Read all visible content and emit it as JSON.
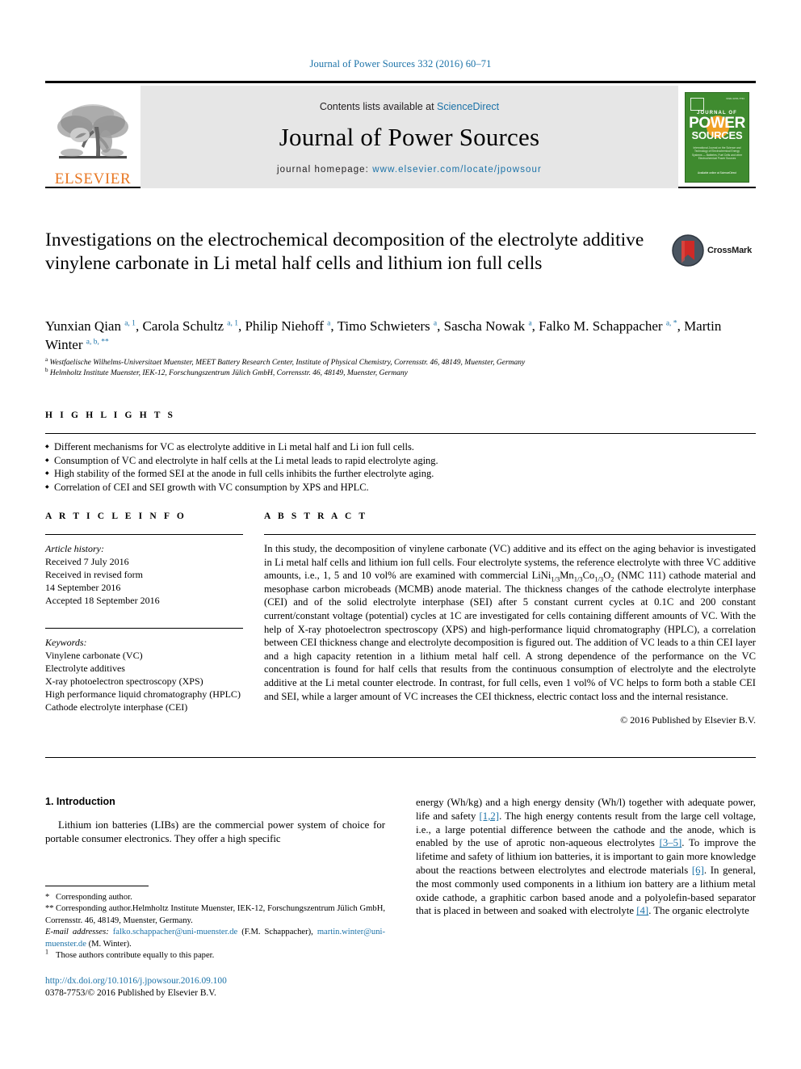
{
  "running_head": "Journal of Power Sources 332 (2016) 60–71",
  "masthead": {
    "publisher_name": "ELSEVIER",
    "contents_prefix": "Contents lists available at ",
    "contents_link": "ScienceDirect",
    "journal_title": "Journal of Power Sources",
    "homepage_prefix": "journal homepage: ",
    "homepage_url": "www.elsevier.com/locate/jpowsour",
    "cover": {
      "issn": "ISSN 0378-7753",
      "line_journal_of": "JOURNAL OF",
      "line_power": "POWER",
      "line_sources": "SOURCES",
      "subtitle": "International Journal on the Science and Technology of Electrochemical Energy Systems — Batteries, Fuel Cells and other Electrochemical Power Sources",
      "footer": "Available online at ScienceDirect"
    }
  },
  "article": {
    "title": "Investigations on the electrochemical decomposition of the electrolyte additive vinylene carbonate in Li metal half cells and lithium ion full cells",
    "crossmark_label": "CrossMark",
    "authors": [
      {
        "name": "Yunxian Qian",
        "sup": "a, 1",
        "sep": ", "
      },
      {
        "name": "Carola Schultz",
        "sup": "a, 1",
        "sep": ", "
      },
      {
        "name": "Philip Niehoff",
        "sup": "a",
        "sep": ", "
      },
      {
        "name": "Timo Schwieters",
        "sup": "a",
        "sep": ", "
      },
      {
        "name": "Sascha Nowak",
        "sup": "a",
        "sep": ", "
      },
      {
        "name": "Falko M. Schappacher",
        "sup": "a, *",
        "sep": ", "
      },
      {
        "name": "Martin Winter",
        "sup": "a, b, **",
        "sep": ""
      }
    ],
    "affiliations": [
      {
        "mark": "a",
        "text": "Westfaelische Wilhelms-Universitaet Muenster, MEET Battery Research Center, Institute of Physical Chemistry, Corrensstr. 46, 48149, Muenster, Germany"
      },
      {
        "mark": "b",
        "text": "Helmholtz Institute Muenster, IEK-12, Forschungszentrum Jülich GmbH, Corrensstr. 46, 48149, Muenster, Germany"
      }
    ]
  },
  "highlights": {
    "heading": "H I G H L I G H T S",
    "items": [
      "Different mechanisms for VC as electrolyte additive in Li metal half and Li ion full cells.",
      "Consumption of VC and electrolyte in half cells at the Li metal leads to rapid electrolyte aging.",
      "High stability of the formed SEI at the anode in full cells inhibits the further electrolyte aging.",
      "Correlation of CEI and SEI growth with VC consumption by XPS and HPLC."
    ]
  },
  "article_info": {
    "heading": "A R T I C L E  I N F O",
    "history_label": "Article history:",
    "history": [
      "Received 7 July 2016",
      "Received in revised form",
      "14 September 2016",
      "Accepted 18 September 2016"
    ],
    "keywords_label": "Keywords:",
    "keywords": [
      "Vinylene carbonate (VC)",
      "Electrolyte additives",
      "X-ray photoelectron spectroscopy (XPS)",
      "High performance liquid chromatography (HPLC)",
      "Cathode electrolyte interphase (CEI)"
    ]
  },
  "abstract": {
    "heading": "A B S T R A C T",
    "part1": "In this study, the decomposition of vinylene carbonate (VC) additive and its effect on the aging behavior is investigated in Li metal half cells and lithium ion full cells. Four electrolyte systems, the reference electrolyte with three VC additive amounts, i.e., 1, 5 and 10 vol% are examined with commercial LiNi",
    "sub1": "1/",
    "part2": "",
    "sub2": "3",
    "part3": "Mn",
    "sub3": "1/3",
    "part4": "Co",
    "sub4": "1/3",
    "part5": "O",
    "sub5": "2",
    "part6": " (NMC 111) cathode material and mesophase carbon microbeads (MCMB) anode material. The thickness changes of the cathode electrolyte interphase (CEI) and of the solid electrolyte interphase (SEI) after 5 constant current cycles at 0.1C and 200 constant current/constant voltage (potential) cycles at 1C are investigated for cells containing different amounts of VC. With the help of X-ray photoelectron spectroscopy (XPS) and high-performance liquid chromatography (HPLC), a correlation between CEI thickness change and electrolyte decomposition is figured out. The addition of VC leads to a thin CEI layer and a high capacity retention in a lithium metal half cell. A strong dependence of the performance on the VC concentration is found for half cells that results from the continuous consumption of electrolyte and the electrolyte additive at the Li metal counter electrode. In contrast, for full cells, even 1 vol% of VC helps to form both a stable CEI and SEI, while a larger amount of VC increases the CEI thickness, electric contact loss and the internal resistance.",
    "copyright": "© 2016 Published by Elsevier B.V."
  },
  "body": {
    "intro_heading": "1. Introduction",
    "left_paragraph": "Lithium ion batteries (LIBs) are the commercial power system of choice for portable consumer electronics. They offer a high specific",
    "right_parts": [
      {
        "text": "energy (Wh/kg) and a high energy density (Wh/l) together with adequate power, life and safety ",
        "cite": ""
      },
      {
        "text": "",
        "cite": "[1,2]"
      },
      {
        "text": ". The high energy contents result from the large cell voltage, i.e., a large potential difference between the cathode and the anode, which is enabled by the use of aprotic non-aqueous electrolytes ",
        "cite": ""
      },
      {
        "text": "",
        "cite": "[3–5]"
      },
      {
        "text": ". To improve the lifetime and safety of lithium ion batteries, it is important to gain more knowledge about the reactions between electrolytes and electrode materials ",
        "cite": ""
      },
      {
        "text": "",
        "cite": "[6]"
      },
      {
        "text": ". In general, the most commonly used components in a lithium ion battery are a lithium metal oxide cathode, a graphitic carbon based anode and a polyolefin-based separator that is placed in between and soaked with electrolyte ",
        "cite": ""
      },
      {
        "text": "",
        "cite": "[4]"
      },
      {
        "text": ". The organic electrolyte",
        "cite": ""
      }
    ]
  },
  "footnotes": {
    "corresponding_1_mark": "*",
    "corresponding_1": "Corresponding author.",
    "corresponding_2_mark": "**",
    "corresponding_2": "Corresponding author.Helmholtz Institute Muenster, IEK-12, Forschungszentrum Jülich GmbH, Corrensstr. 46, 48149, Muenster, Germany.",
    "email_label": "E-mail addresses:",
    "email_1": "falko.schappacher@uni-muenster.de",
    "email_1_owner": "(F.M. Schappacher),",
    "email_2": "martin.winter@uni-muenster.de",
    "email_2_owner": "(M. Winter).",
    "equal_mark": "1",
    "equal_contribution": "Those authors contribute equally to this paper."
  },
  "footer": {
    "doi": "http://dx.doi.org/10.1016/j.jpowsour.2016.09.100",
    "issn_line": "0378-7753/© 2016 Published by Elsevier B.V."
  },
  "colors": {
    "link_blue": "#1b72a8",
    "elsevier_orange": "#e87722",
    "cover_green": "#3f8b2f",
    "masthead_gray": "#e6e6e6"
  }
}
